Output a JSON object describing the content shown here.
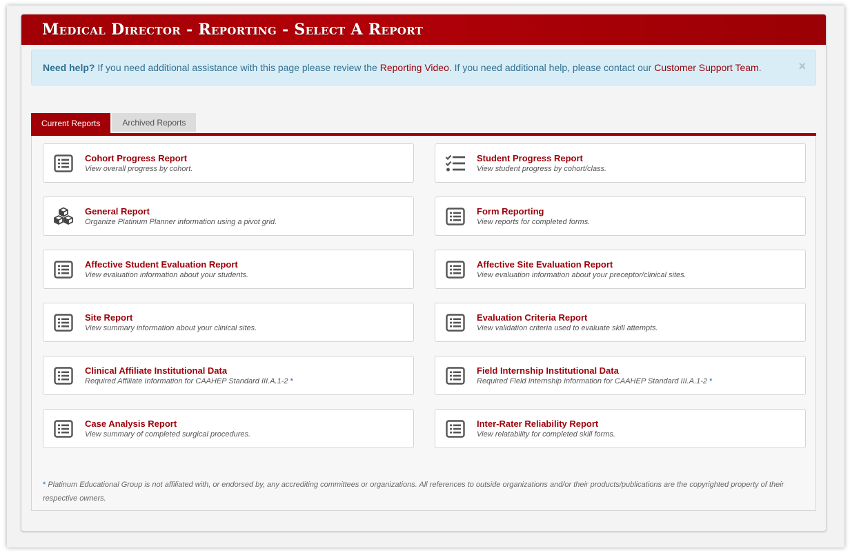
{
  "header": {
    "title": "Medical Director - Reporting - Select A Report"
  },
  "help": {
    "lead": "Need help?",
    "text1": " If you need additional assistance with this page please review the ",
    "link1": "Reporting Video",
    "text2": ". If you need additional help, please contact our ",
    "link2": "Customer Support Team",
    "text3": ".",
    "close": "×"
  },
  "tabs": [
    {
      "label": "Current Reports"
    },
    {
      "label": "Archived Reports"
    }
  ],
  "reports": [
    {
      "title": "Cohort Progress Report",
      "desc": "View overall progress by cohort.",
      "icon": "list-icon"
    },
    {
      "title": "Student Progress Report",
      "desc": "View student progress by cohort/class.",
      "icon": "tasks-icon"
    },
    {
      "title": "General Report",
      "desc": "Organize Platinum Planner information using a pivot grid.",
      "icon": "cubes-icon"
    },
    {
      "title": "Form Reporting",
      "desc": "View reports for completed forms.",
      "icon": "list-icon"
    },
    {
      "title": "Affective Student Evaluation Report",
      "desc": "View evaluation information about your students.",
      "icon": "list-icon"
    },
    {
      "title": "Affective Site Evaluation Report",
      "desc": "View evaluation information about your preceptor/clinical sites.",
      "icon": "list-icon"
    },
    {
      "title": "Site Report",
      "desc": "View summary information about your clinical sites.",
      "icon": "list-icon"
    },
    {
      "title": "Evaluation Criteria Report",
      "desc": "View validation criteria used to evaluate skill attempts.",
      "icon": "list-icon"
    },
    {
      "title": "Clinical Affiliate Institutional Data",
      "desc": "Required Affiliate Information for CAAHEP Standard III.A.1-2",
      "icon": "list-icon"
    },
    {
      "title": "Field Internship Institutional Data",
      "desc": "Required Field Internship Information for CAAHEP Standard III.A.1-2",
      "icon": "list-icon"
    },
    {
      "title": "Case Analysis Report",
      "desc": "View summary of completed surgical procedures.",
      "icon": "list-icon"
    },
    {
      "title": "Inter-Rater Reliability Report",
      "desc": "View relatability for completed skill forms.",
      "icon": "list-icon"
    }
  ],
  "asterisk": "*",
  "footnote": {
    "text": " Platinum Educational Group is not affiliated with, or endorsed by, any accrediting committees or organizations. All references to outside organizations and/or their products/publications are the copyrighted property of their respective owners."
  },
  "colors": {
    "brand": "#a00006",
    "link": "#9b0008",
    "alert_bg": "#d9edf7",
    "alert_text": "#31708f"
  }
}
